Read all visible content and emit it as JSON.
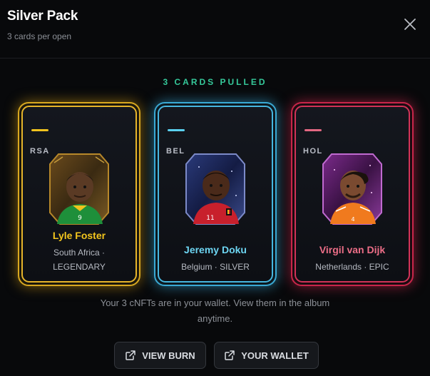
{
  "header": {
    "title": "Silver Pack",
    "subtitle": "3 cards per open"
  },
  "pulled_label": "3 CARDS PULLED",
  "cards": [
    {
      "rarity": "gold",
      "country_code": "RSA",
      "name": "Lyle Foster",
      "meta_line1": "South Africa ·",
      "meta_line2": "LEGENDARY",
      "accent": "#e7b52a"
    },
    {
      "rarity": "silver",
      "country_code": "BEL",
      "name": "Jeremy Doku",
      "meta_line1": "Belgium · SILVER",
      "accent": "#47b7e0"
    },
    {
      "rarity": "epic",
      "country_code": "HOL",
      "name": "Virgil van Dijk",
      "meta_line1": "Netherlands · EPIC",
      "accent": "#d23358"
    }
  ],
  "info": {
    "line1": "Your 3 cNFTs are in your wallet. View them in the album",
    "line2": "anytime."
  },
  "buttons": {
    "burn_label": "VIEW BURN",
    "wallet_label": "YOUR WALLET"
  },
  "icons": {
    "close": "close-icon",
    "external": "external-link-icon"
  }
}
